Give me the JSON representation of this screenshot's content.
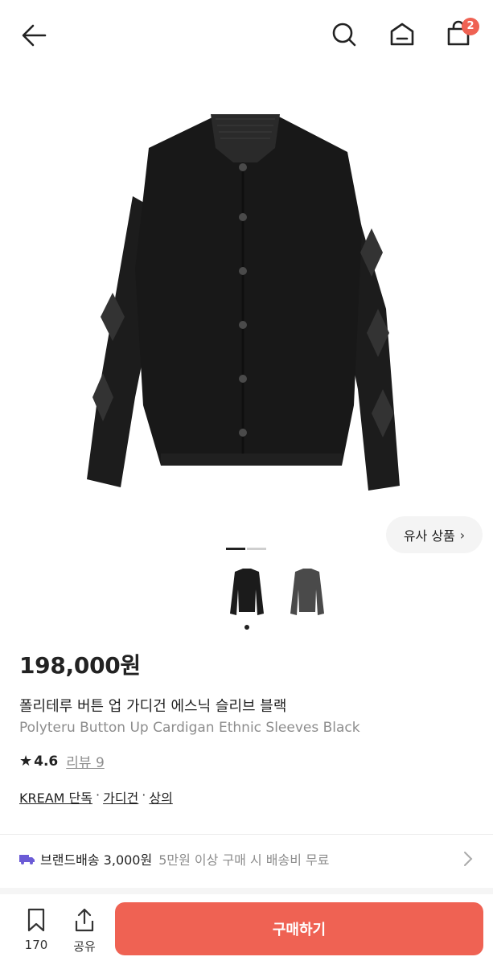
{
  "header": {
    "cart_count": "2",
    "icons": [
      "back-arrow-icon",
      "search-icon",
      "home-icon",
      "shopping-bag-icon"
    ]
  },
  "gallery": {
    "similar_label": "유사 상품",
    "current_page": 1,
    "total_pages": 2,
    "thumbnails": [
      "cardigan-front",
      "cardigan-grey"
    ]
  },
  "product": {
    "price": "198,000원",
    "name_ko": "폴리테루 버튼 업 가디건 에스닉 슬리브 블랙",
    "name_en": "Polyteru Button Up Cardigan Ethnic Sleeves Black",
    "rating": "4.6",
    "review_label": "리뷰 9",
    "tags": [
      "KREAM 단독",
      "가디건",
      "상의"
    ]
  },
  "shipping": {
    "label": "브랜드배송 3,000원",
    "note": "5만원 이상 구매 시 배송비 무료"
  },
  "bottom_bar": {
    "bookmark_count": "170",
    "share_label": "공유",
    "buy_label": "구매하기"
  },
  "colors": {
    "accent": "#ef6253",
    "shipping_icon": "#6b5bd6",
    "text_primary": "#222222",
    "text_muted": "#8d8d8d"
  }
}
